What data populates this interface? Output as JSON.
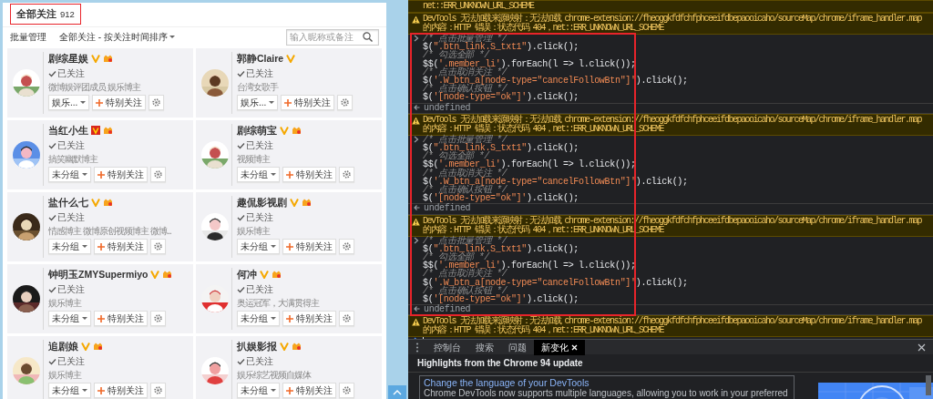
{
  "follow_panel": {
    "title": "全部关注",
    "count": "912",
    "toolbar": {
      "batch": "批量管理",
      "sort": "全部关注 - 按关注时间排序",
      "search": {
        "placeholder": "输入昵称或备注"
      }
    },
    "users": [
      {
        "name": "剧综星娱",
        "verified": {
          "kind": "mark",
          "color": "#f5a800"
        },
        "vip": true,
        "status": "已关注",
        "bio": "微博娱评团成员 娱乐博主",
        "group": "娱乐...",
        "special": "特别关注"
      },
      {
        "name": "郭静Claire",
        "verified": {
          "kind": "mark",
          "color": "#f5a800"
        },
        "vip": false,
        "status": "已关注",
        "bio": "台湾女歌手",
        "group": "娱乐...",
        "special": "特别关注"
      },
      {
        "name": "当红小生",
        "verified": {
          "kind": "box",
          "color": "#d9261c"
        },
        "vip": true,
        "status": "已关注",
        "bio": "搞笑幽默博主",
        "group": "未分组",
        "special": "特别关注"
      },
      {
        "name": "剧综萌宝",
        "verified": {
          "kind": "mark",
          "color": "#f5a800"
        },
        "vip": true,
        "status": "已关注",
        "bio": "视频博主",
        "group": "未分组",
        "special": "特别关注"
      },
      {
        "name": "盐什么七",
        "verified": {
          "kind": "mark",
          "color": "#f5a800"
        },
        "vip": true,
        "status": "已关注",
        "bio": "情感博主 微博原创视频博主 微博...",
        "group": "未分组",
        "special": "特别关注"
      },
      {
        "name": "趣侃影视剧",
        "verified": {
          "kind": "mark",
          "color": "#f5a800"
        },
        "vip": true,
        "status": "已关注",
        "bio": "娱乐博主",
        "group": "未分组",
        "special": "特别关注"
      },
      {
        "name": "钟明玉ZMYSupermiyo",
        "verified": {
          "kind": "mark",
          "color": "#f5a800"
        },
        "vip": true,
        "status": "已关注",
        "bio": "娱乐博主",
        "group": "未分组",
        "special": "特别关注"
      },
      {
        "name": "何冲",
        "verified": {
          "kind": "mark",
          "color": "#f5a800"
        },
        "vip": true,
        "status": "已关注",
        "bio": "奥运冠军，大满贯得主",
        "group": "未分组",
        "special": "特别关注"
      },
      {
        "name": "追剧娘",
        "verified": {
          "kind": "mark",
          "color": "#f5a800"
        },
        "vip": true,
        "status": "已关注",
        "bio": "娱乐博主",
        "group": "未分组",
        "special": "特别关注"
      },
      {
        "name": "扒娱影报",
        "verified": {
          "kind": "mark",
          "color": "#f5a800"
        },
        "vip": true,
        "status": "已关注",
        "bio": "娱乐综艺视频自媒体",
        "group": "未分组",
        "special": "特别关注"
      }
    ]
  },
  "console": {
    "entries": [
      {
        "kind": "warning_tail",
        "text": "net::ERR_UNKNOWN_URL_SCHEME"
      },
      {
        "kind": "warning",
        "before": "DevTools 无法加载来源映射：无法加载 ",
        "link": "chrome-extension://fheoggkfdfchfphceeifdbepaooicaho/sourceMap/chrome/iframe_handler.map",
        "after": " 的内容：HTTP 错误：状态代码 404，net::ERR_UNKNOWN_URL_SCHEME"
      },
      {
        "kind": "input",
        "lines": [
          {
            "kind": "comment",
            "text": "/* 点击批量管理 */"
          },
          {
            "kind": "code",
            "text": "$(\".btn_link.S_txt1\").click();"
          },
          {
            "kind": "comment",
            "text": "/* 勾选全部 */"
          },
          {
            "kind": "code",
            "text": "$$('.member_li').forEach(l => l.click());"
          },
          {
            "kind": "comment",
            "text": "/* 点击取消关注 */"
          },
          {
            "kind": "code",
            "text": "$('.W_btn_a[node-type=\"cancelFollowBtn\"]').click();"
          },
          {
            "kind": "comment",
            "text": "/* 点击确认按钮 */"
          },
          {
            "kind": "code",
            "text": "$('[node-type=\"ok\"]').click();"
          }
        ]
      },
      {
        "kind": "result",
        "text": "undefined"
      },
      {
        "kind": "warning",
        "before": "DevTools 无法加载来源映射：无法加载 ",
        "link": "chrome-extension://fheoggkfdfchfphceeifdbepaooicaho/sourceMap/chrome/iframe_handler.map",
        "after": " 的内容：HTTP 错误：状态代码 404，net::ERR_UNKNOWN_URL_SCHEME"
      },
      {
        "kind": "input",
        "lines": [
          {
            "kind": "comment",
            "text": "/* 点击批量管理 */"
          },
          {
            "kind": "code",
            "text": "$(\".btn_link.S_txt1\").click();"
          },
          {
            "kind": "comment",
            "text": "/* 勾选全部 */"
          },
          {
            "kind": "code",
            "text": "$$('.member_li').forEach(l => l.click());"
          },
          {
            "kind": "comment",
            "text": "/* 点击取消关注 */"
          },
          {
            "kind": "code",
            "text": "$('.W_btn_a[node-type=\"cancelFollowBtn\"]').click();"
          },
          {
            "kind": "comment",
            "text": "/* 点击确认按钮 */"
          },
          {
            "kind": "code",
            "text": "$('[node-type=\"ok\"]').click();"
          }
        ]
      },
      {
        "kind": "result",
        "text": "undefined"
      },
      {
        "kind": "warning",
        "before": "DevTools 无法加载来源映射：无法加载 ",
        "link": "chrome-extension://fheoggkfdfchfphceeifdbepaooicaho/sourceMap/chrome/iframe_handler.map",
        "after": " 的内容：HTTP 错误：状态代码 404，net::ERR_UNKNOWN_URL_SCHEME"
      },
      {
        "kind": "input",
        "lines": [
          {
            "kind": "comment",
            "text": "/* 点击批量管理 */"
          },
          {
            "kind": "code",
            "text": "$(\".btn_link.S_txt1\").click();"
          },
          {
            "kind": "comment",
            "text": "/* 勾选全部 */"
          },
          {
            "kind": "code",
            "text": "$$('.member_li').forEach(l => l.click());"
          },
          {
            "kind": "comment",
            "text": "/* 点击取消关注 */"
          },
          {
            "kind": "code",
            "text": "$('.W_btn_a[node-type=\"cancelFollowBtn\"]').click();"
          },
          {
            "kind": "comment",
            "text": "/* 点击确认按钮 */"
          },
          {
            "kind": "code",
            "text": "$('[node-type=\"ok\"]').click();"
          }
        ]
      },
      {
        "kind": "result",
        "text": "undefined"
      },
      {
        "kind": "warning",
        "before": "DevTools 无法加载来源映射：无法加载 ",
        "link": "chrome-extension://fheoggkfdfchfphceeifdbepaooicaho/sourceMap/chrome/iframe_handler.map",
        "after": " 的内容：HTTP 错误：状态代码 404，net::ERR_UNKNOWN_URL_SCHEME"
      },
      {
        "kind": "prompt"
      }
    ]
  },
  "drawer": {
    "tabs": [
      {
        "label": "控制台",
        "selected": false,
        "closable": false
      },
      {
        "label": "搜索",
        "selected": false,
        "closable": false
      },
      {
        "label": "问题",
        "selected": false,
        "closable": false
      },
      {
        "label": "新变化",
        "selected": true,
        "closable": true
      }
    ],
    "heading": "Highlights from the Chrome 94 update",
    "card": {
      "title": "Change the language of your DevTools",
      "text": "Chrome DevTools now supports multiple languages, allowing you to work in your preferred"
    }
  }
}
